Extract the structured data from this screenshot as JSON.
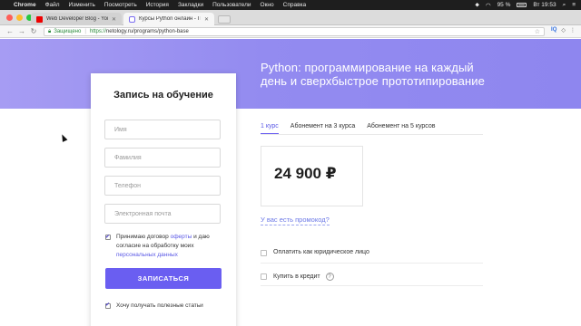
{
  "menubar": {
    "app": "Chrome",
    "items": [
      "Файл",
      "Изменить",
      "Посмотреть",
      "История",
      "Закладки",
      "Пользователи",
      "Окно",
      "Справка"
    ],
    "battery": "95 %",
    "clock": "Вт 19:53"
  },
  "tabs": [
    {
      "title": "Web Developer Blog - YouTube",
      "favicon": "youtube-icon"
    },
    {
      "title": "Курсы Python онлайн - Прогр...",
      "favicon": "netology-icon"
    }
  ],
  "address": {
    "secure_label": "Защищено",
    "protocol": "https://",
    "url": "netology.ru/programs/python-base"
  },
  "toolbar_right": {
    "ext": "IQ"
  },
  "hero": {
    "title": "Python: программирование на каждый день и сверхбыстрое прототипирование"
  },
  "form": {
    "title": "Запись на обучение",
    "fields": [
      {
        "placeholder": "Имя",
        "value": ""
      },
      {
        "placeholder": "Фамилия",
        "value": ""
      },
      {
        "placeholder": "Телефон",
        "value": ""
      },
      {
        "placeholder": "Электронная почта",
        "value": ""
      }
    ],
    "agree_prefix": "Принимаю договор ",
    "agree_link1": "оферты",
    "agree_middle": " и даю согласие на обработку моих ",
    "agree_link2": "персональных данных",
    "agree_checked": true,
    "submit_label": "ЗАПИСАТЬСЯ",
    "newsletter_label": "Хочу получать полезные статьи",
    "newsletter_checked": true
  },
  "plans": {
    "tabs": [
      "1 курс",
      "Абонемент на 3 курса",
      "Абонемент на 5 курсов"
    ],
    "active_index": 0,
    "price": "24 900 ₽",
    "promo_link": "У вас есть промокод?",
    "options": [
      {
        "label": "Оплатить как юридическое лицо",
        "checked": false
      },
      {
        "label": "Купить в кредит",
        "checked": false,
        "help": "?"
      }
    ]
  },
  "colors": {
    "accent": "#6a5ef1",
    "hero": "#938bf0",
    "link": "#5b59e6"
  }
}
